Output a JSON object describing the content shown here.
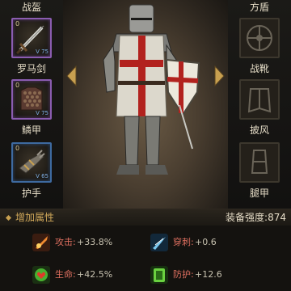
{
  "equipment": {
    "left": [
      {
        "label": "战盔",
        "type": "header"
      },
      {
        "label": "罗马剑",
        "count": "0",
        "level": "V 75",
        "icon": "sword-icon"
      },
      {
        "label": "鳞甲",
        "count": "0",
        "level": "V 75",
        "icon": "scale-armor-icon"
      },
      {
        "label": "护手",
        "count": "0",
        "level": "V 65",
        "icon": "gauntlet-icon"
      }
    ],
    "right": [
      {
        "label": "方盾",
        "type": "header"
      },
      {
        "label": "战靴",
        "icon": "boots-icon"
      },
      {
        "label": "披风",
        "icon": "cloak-icon"
      },
      {
        "label": "腿甲",
        "icon": "greaves-icon"
      }
    ]
  },
  "attributes": {
    "title": "增加属性",
    "power_label": "装备强度:874",
    "stats": [
      {
        "name": "攻击",
        "value": "+33.8%",
        "icon": "attack-icon"
      },
      {
        "name": "穿刺",
        "value": "+0.6",
        "icon": "pierce-icon"
      },
      {
        "name": "生命",
        "value": "+42.5%",
        "icon": "life-icon"
      },
      {
        "name": "防护",
        "value": "+12.6",
        "icon": "defense-icon"
      }
    ]
  },
  "colors": {
    "accent": "#d0a85a",
    "stat_name": "#e07060",
    "purple_frame": "#8a5cb0",
    "blue_frame": "#3e6aa0"
  }
}
